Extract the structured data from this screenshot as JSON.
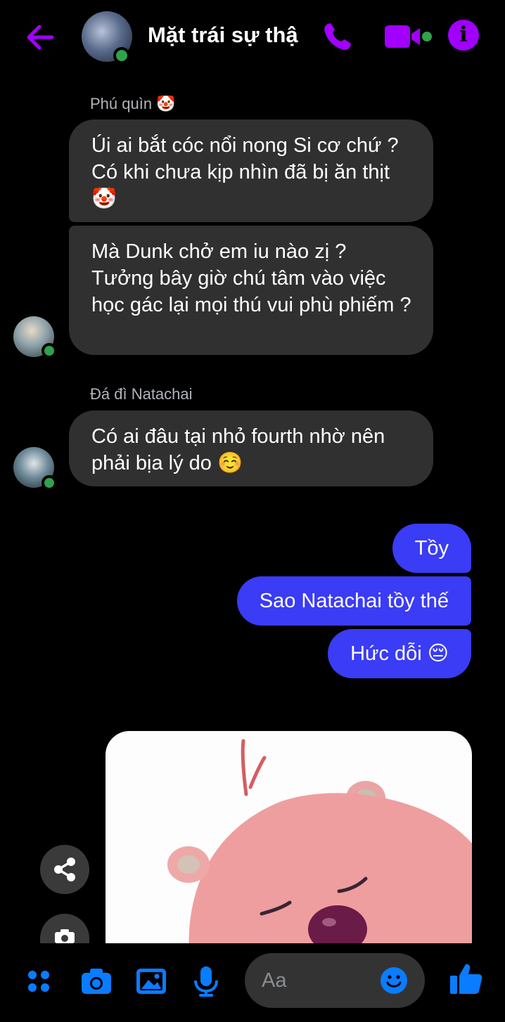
{
  "header": {
    "title": "Mặt trái sự thậ",
    "accent_color": "#a100ff",
    "online_color": "#31a24c"
  },
  "messages_in": [
    {
      "sender": "Phú quìn 🤡",
      "bubbles": [
        "Úi ai bắt cóc nổi nong Si cơ chứ ? Có khi chưa kịp nhìn đã bị ăn thịt 🤡",
        "Mà Dunk chở em iu nào zị ? Tưởng bây giờ chú tâm vào việc học gác lại mọi thú vui phù phiếm ?"
      ]
    },
    {
      "sender": "Đá đì Natachai",
      "bubbles": [
        "Có ai đâu tại nhỏ fourth nhờ nên phải bịa lý do ☺️"
      ]
    }
  ],
  "messages_out": [
    "Tồy",
    "Sao Natachai tồy thế",
    "Hức dỗi 😔"
  ],
  "outgoing_color": "#3a3cf6",
  "incoming_color": "#303030",
  "composer": {
    "placeholder": "Aa",
    "tool_color": "#0a7cff"
  },
  "icons": [
    "back-arrow-icon",
    "phone-icon",
    "video-camera-icon",
    "info-icon",
    "share-icon",
    "camera-icon",
    "menu-grid-icon",
    "image-icon",
    "microphone-icon",
    "emoji-icon",
    "thumbs-up-icon"
  ]
}
